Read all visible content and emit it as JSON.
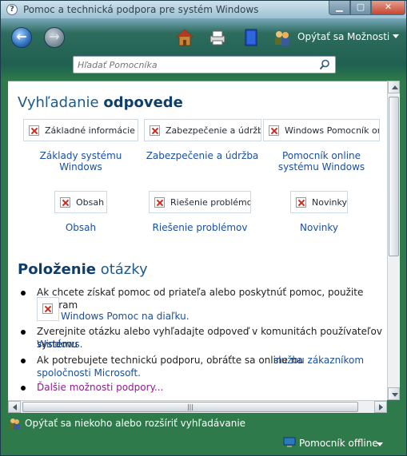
{
  "window": {
    "title": "Pomoc a technická podpora pre systém Windows",
    "minimize_glyph": "▁",
    "maximize_glyph": "▢",
    "close_glyph": "✕"
  },
  "toolbar": {
    "back_glyph": "←",
    "forward_glyph": "→",
    "ask_label": "Opýtať sa",
    "options_label": "Možnosti"
  },
  "search": {
    "placeholder": "Hľadať Pomocníka",
    "value": ""
  },
  "content": {
    "section1_title_normal": "Vyhľadanie ",
    "section1_title_bold": "odpovede",
    "tiles": [
      {
        "tile_text": "Základné informácie o sy",
        "link_text": "Základy systému Windows"
      },
      {
        "tile_text": "Zabezpečenie a údržba",
        "link_text": "Zabezpečenie a údržba"
      },
      {
        "tile_text": "Windows Pomocník onl",
        "link_text": "Pomocník online systému Windows"
      },
      {
        "tile_text": "Obsah",
        "link_text": "Obsah"
      },
      {
        "tile_text": "Riešenie problémov",
        "link_text": "Riešenie problémov"
      },
      {
        "tile_text": "Novinky",
        "link_text": "Novinky"
      }
    ],
    "section2_title_bold": "Položenie",
    "section2_title_normal": " otázky",
    "bullets": {
      "b1_text": "Ak chcete získať pomoc od priateľa alebo poskytnúť pomoc, použite program",
      "b1_link": "Windows Pomoc na diaľku.",
      "b2_text": "Zverejnite otázku alebo vyhľadajte odpoveď v komunitách používateľov systému",
      "b2_link": "Windows.",
      "b3_text": "Ak potrebujete technickú podporu, obráťte sa online na ",
      "b3_link1": "službu zákazníkom",
      "b3_link2": "spoločnosti Microsoft.",
      "b4_link": "Ďalšie možnosti podpory..."
    }
  },
  "status": {
    "ask_text": "Opýtať sa niekoho alebo rozšíriť vyhľadávanie",
    "offline_label": "Pomocník offline"
  },
  "colors": {
    "heading": "#1d5b8c",
    "link": "#1a4fa0",
    "visited_link": "#8a1e8a"
  }
}
